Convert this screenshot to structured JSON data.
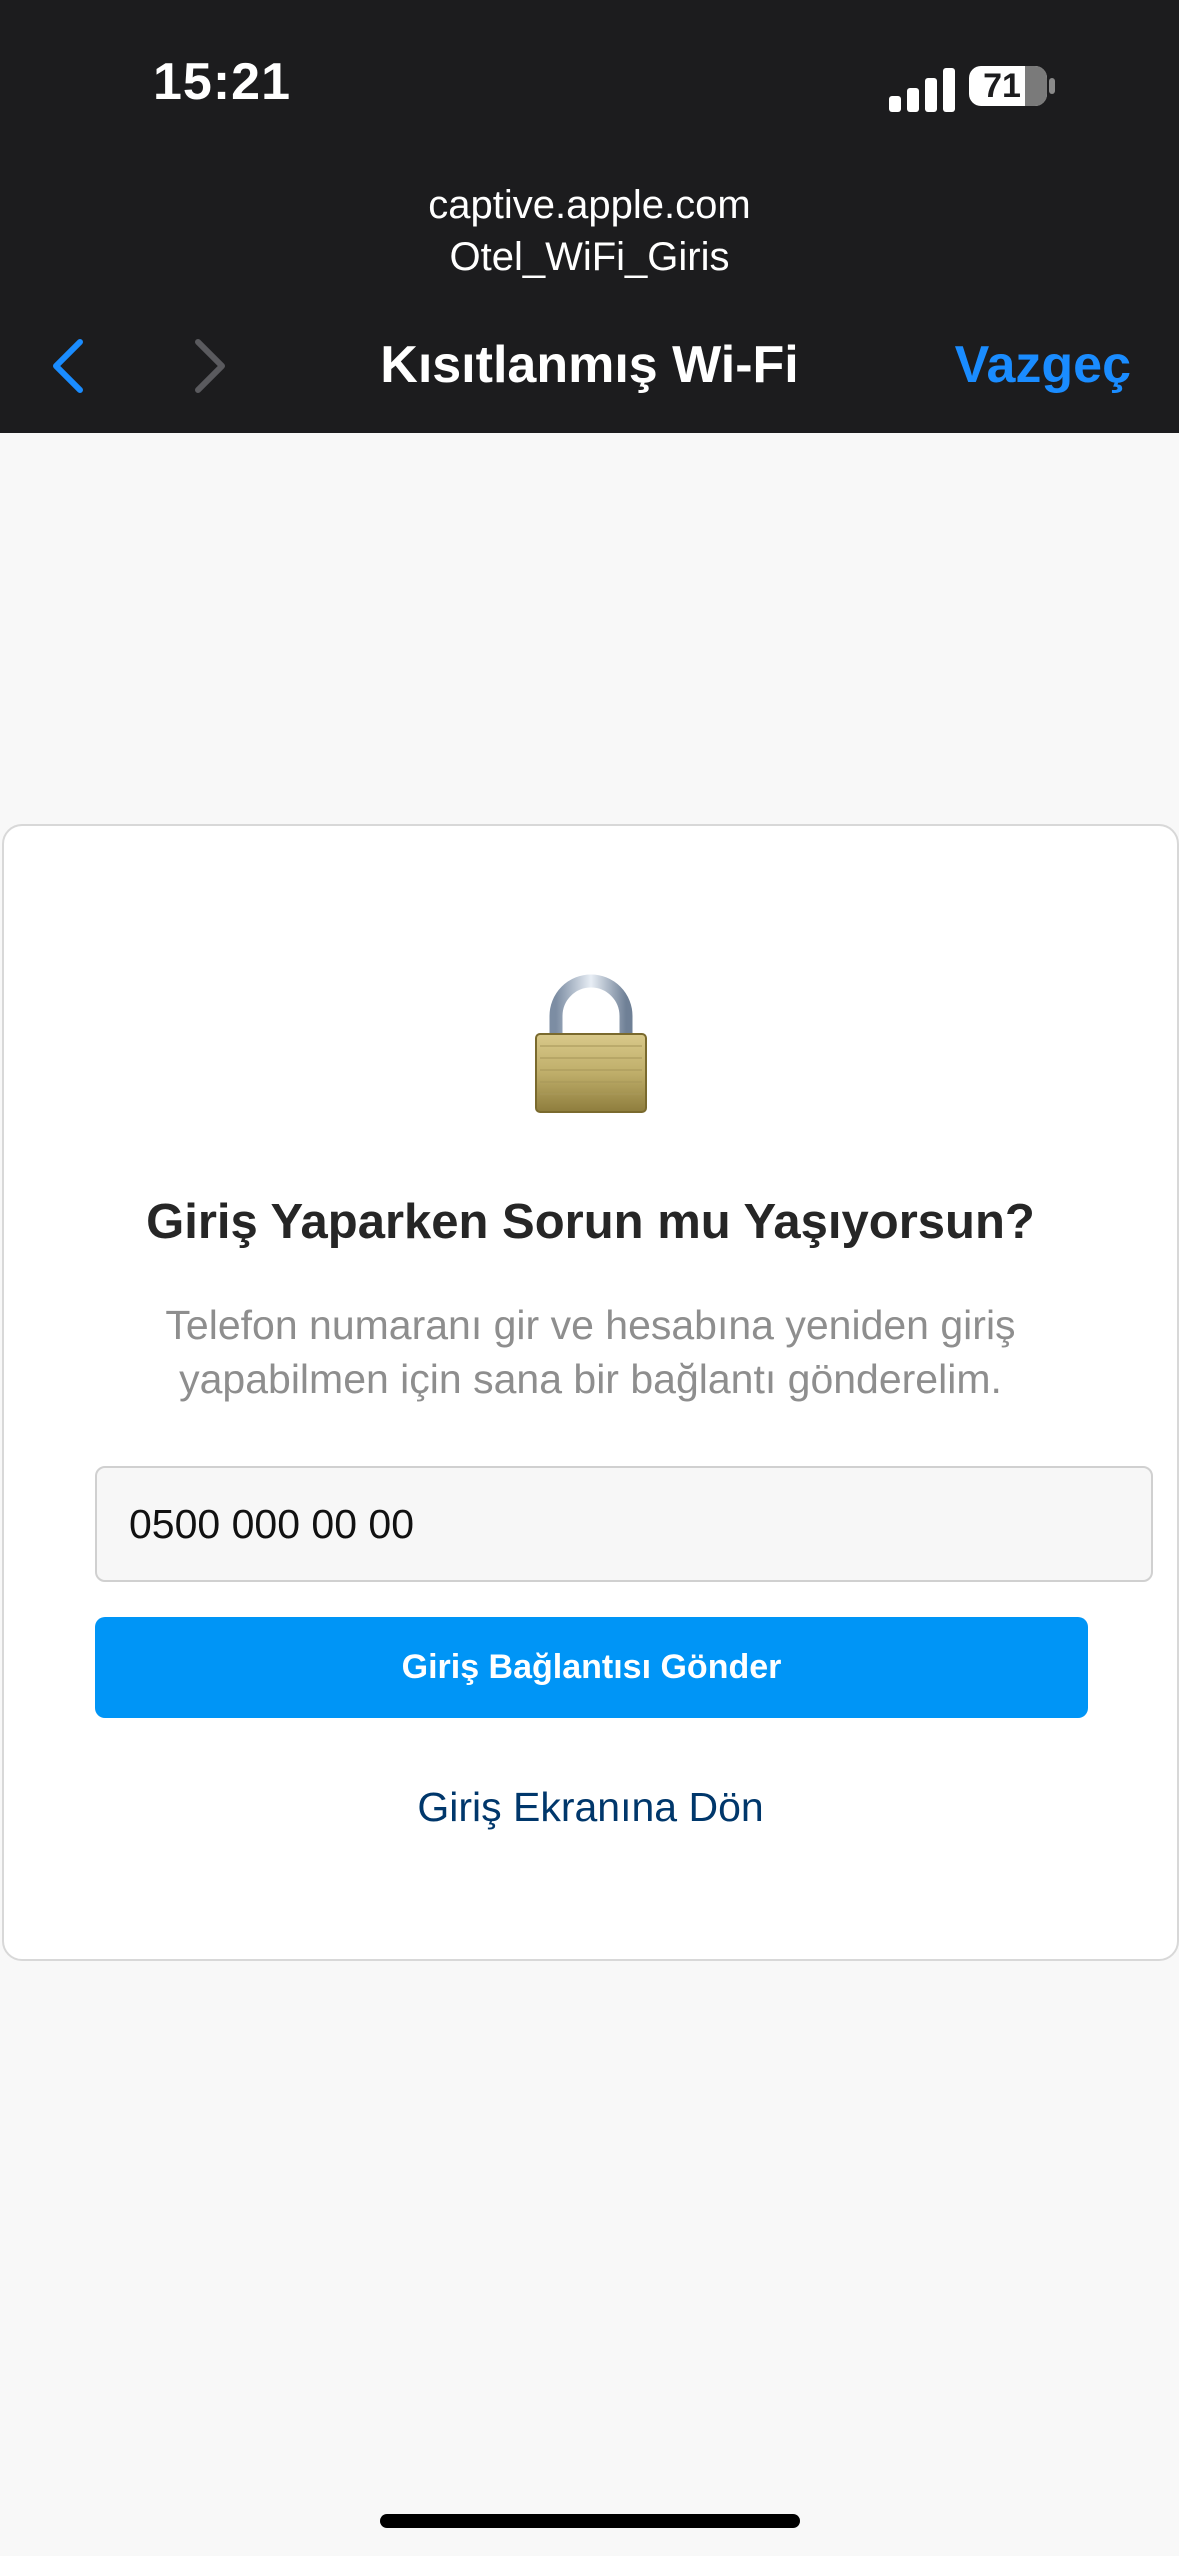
{
  "status_bar": {
    "time": "15:21",
    "battery_level": "71",
    "signal_bars": 4
  },
  "browser_header": {
    "host": "captive.apple.com",
    "network_name": "Otel_WiFi_Giris",
    "title": "Kısıtlanmış Wi-Fi",
    "cancel_label": "Vazgeç",
    "back_icon": "chevron-left-icon",
    "forward_icon": "chevron-right-icon"
  },
  "card": {
    "icon": "lock-icon",
    "title": "Giriş Yaparken Sorun mu Yaşıyorsun?",
    "description": "Telefon numaranı gir ve hesabına yeniden giriş yapabilmen için sana bir bağlantı gönderelim.",
    "phone_value": "0500 000 00 00",
    "send_button_label": "Giriş Bağlantısı Gönder",
    "back_link_label": "Giriş Ekranına Dön"
  },
  "colors": {
    "header_bg": "#1c1c1e",
    "accent_blue": "#1a8cff",
    "button_blue": "#0095f6",
    "link_dark_blue": "#00376b"
  }
}
